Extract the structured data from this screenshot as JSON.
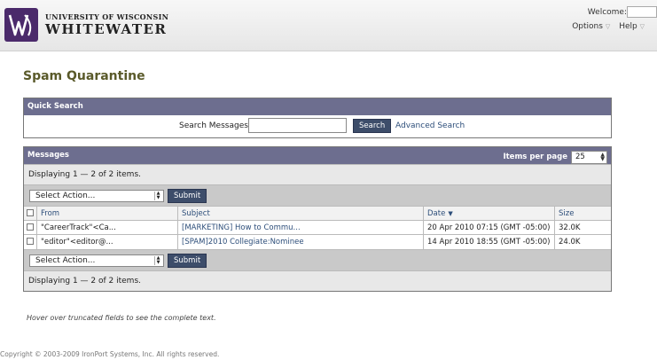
{
  "header": {
    "university_line1": "UNIVERSITY OF WISCONSIN",
    "university_line2": "WHITEWATER",
    "welcome": "Welcome:",
    "menu": [
      {
        "label": "Options"
      },
      {
        "label": "Help"
      }
    ]
  },
  "page_title": "Spam Quarantine",
  "quick_search": {
    "title": "Quick Search",
    "label": "Search Messages:",
    "value": "",
    "button": "Search",
    "advanced_link": "Advanced Search"
  },
  "messages": {
    "title": "Messages",
    "items_per_page_label": "Items per page",
    "items_per_page_value": "25",
    "displaying_top": "Displaying 1 — 2 of 2 items.",
    "displaying_bottom": "Displaying 1 — 2 of 2 items.",
    "select_action": "Select Action...",
    "submit": "Submit",
    "columns": {
      "from": "From",
      "subject": "Subject",
      "date": "Date",
      "size": "Size"
    },
    "rows": [
      {
        "from": "\"CareerTrack\"<Ca...",
        "subject": "[MARKETING] How to Commu...",
        "date": "20 Apr 2010 07:15 (GMT -05:00)",
        "size": "32.0K"
      },
      {
        "from": "\"editor\"<editor@...",
        "subject": "[SPAM]2010 Collegiate:Nominee",
        "date": "14 Apr 2010 18:55 (GMT -05:00)",
        "size": "24.0K"
      }
    ]
  },
  "hint": "Hover over truncated fields to see the complete text.",
  "copyright": "Copyright © 2003-2009 IronPort Systems, Inc. All rights reserved.",
  "colors": {
    "brand": "#4b2a6b",
    "panel_header": "#6d6e8f",
    "button": "#3d4d6a",
    "title": "#5a5a2a",
    "link": "#2d4e7a"
  }
}
